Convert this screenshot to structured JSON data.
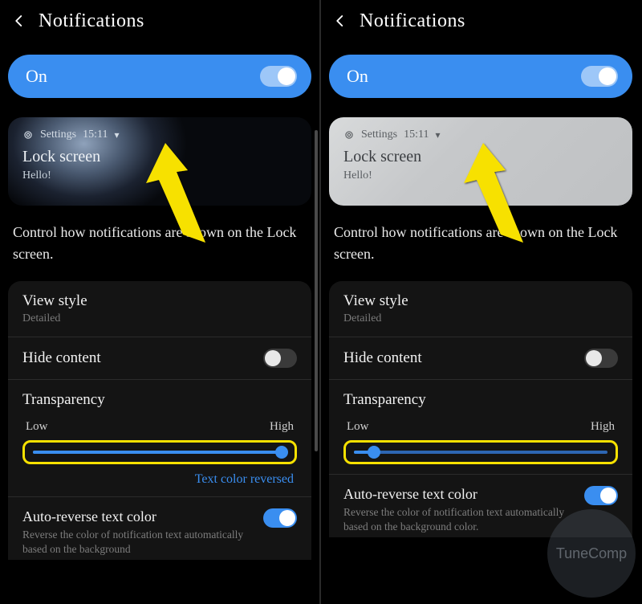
{
  "header": {
    "title": "Notifications"
  },
  "switch": {
    "on_label": "On"
  },
  "preview": {
    "app": "Settings",
    "time": "15:11",
    "title": "Lock screen",
    "body": "Hello!"
  },
  "description": "Control how notifications are shown on the Lock screen.",
  "view_style": {
    "label": "View style",
    "value": "Detailed"
  },
  "hide_content": {
    "label": "Hide content",
    "value": false
  },
  "transparency": {
    "label": "Transparency",
    "low": "Low",
    "high": "High",
    "left_value_pct": 98,
    "right_value_pct": 8
  },
  "text_reversed": "Text color reversed",
  "auto_reverse": {
    "label": "Auto-reverse text color",
    "desc_left": "Reverse the color of notification text automatically based on the background",
    "desc_right": "Reverse the color of notification text automatically based on the background color.",
    "value": true
  },
  "watermark": "TuneComp"
}
